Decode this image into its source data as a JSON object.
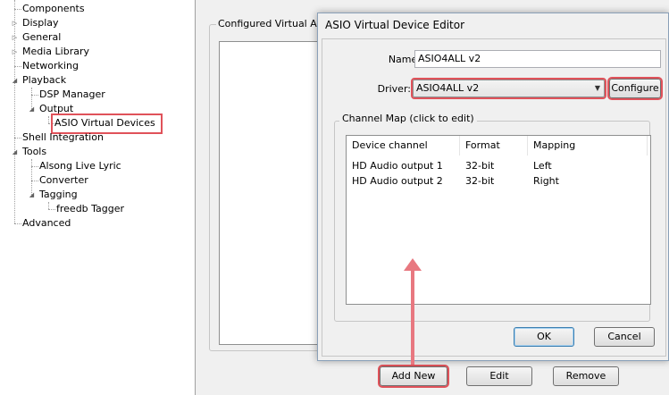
{
  "tree": {
    "items": [
      {
        "label": "Components"
      },
      {
        "label": "Display"
      },
      {
        "label": "General"
      },
      {
        "label": "Media Library"
      },
      {
        "label": "Networking"
      },
      {
        "label": "Playback"
      },
      {
        "label": "DSP Manager"
      },
      {
        "label": "Output"
      },
      {
        "label": "ASIO Virtual Devices"
      },
      {
        "label": "Shell Integration"
      },
      {
        "label": "Tools"
      },
      {
        "label": "Alsong Live Lyric"
      },
      {
        "label": "Converter"
      },
      {
        "label": "Tagging"
      },
      {
        "label": "freedb Tagger"
      },
      {
        "label": "Advanced"
      }
    ]
  },
  "main": {
    "group_title": "Configured Virtual ASIO",
    "buttons": {
      "add_new": "Add New",
      "edit": "Edit",
      "remove": "Remove"
    }
  },
  "dialog": {
    "title": "ASIO Virtual Device Editor",
    "name_label": "Name:",
    "name_value": "ASIO4ALL v2",
    "driver_label": "Driver:",
    "driver_value": "ASIO4ALL v2",
    "configure_label": "Configure",
    "channel_map_title": "Channel Map (click to edit)",
    "columns": [
      "Device channel",
      "Format",
      "Mapping"
    ],
    "rows": [
      [
        "HD Audio output 1",
        "32-bit",
        "Left"
      ],
      [
        "HD Audio output 2",
        "32-bit",
        "Right"
      ]
    ],
    "ok_label": "OK",
    "cancel_label": "Cancel"
  },
  "colors": {
    "highlight": "#e0525a",
    "arrow": "#e87880"
  }
}
